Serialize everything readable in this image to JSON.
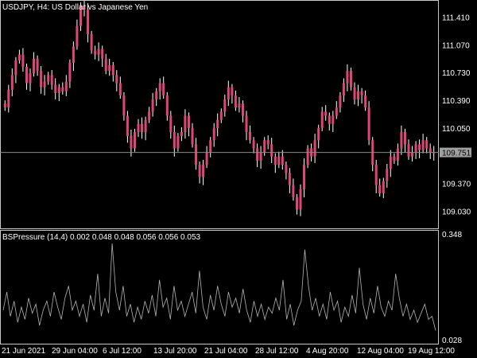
{
  "colors": {
    "background": "#000000",
    "frame": "#c8c8c8",
    "candle": "#e0457a",
    "wick": "#ffffff",
    "indicator": "#b4b4b4",
    "current_price_line": "#8a8a8a",
    "current_price_box": "#a0a0a0",
    "text": "#ffffff"
  },
  "main": {
    "header": "USDJPY, H4:  US Dollar vs Japanese Yen",
    "price_ticks": [
      "111.410",
      "111.070",
      "110.730",
      "110.390",
      "110.050",
      "109.370",
      "109.030"
    ],
    "current_price": "109.751"
  },
  "indicator": {
    "header": "BSPressure (14,4) 0.002 0.048 0.048 0.056 0.056 0.053",
    "ticks": [
      "0.348",
      "0.028"
    ]
  },
  "time_axis": {
    "labels": [
      "21 Jun 2021",
      "29 Jun 04:00",
      "6 Jul 12:00",
      "13 Jul 20:00",
      "21 Jul 04:00",
      "28 Jul 12:00",
      "4 Aug 20:00",
      "12 Aug 04:00",
      "19 Aug 12:00"
    ]
  },
  "chart_data": [
    {
      "type": "candlestick",
      "title": "USDJPY, H4:  US Dollar vs Japanese Yen",
      "ylim": [
        108.83,
        111.6
      ],
      "y_ticks": [
        111.41,
        111.07,
        110.73,
        110.39,
        110.05,
        109.37,
        109.03
      ],
      "current_price": 109.751,
      "x_labels": [
        "21 Jun 2021",
        "29 Jun 04:00",
        "6 Jul 12:00",
        "13 Jul 20:00",
        "21 Jul 04:00",
        "28 Jul 12:00",
        "4 Aug 20:00",
        "12 Aug 04:00",
        "19 Aug 12:00"
      ],
      "close": [
        110.3,
        110.52,
        110.7,
        110.88,
        110.95,
        110.8,
        110.6,
        110.72,
        110.9,
        110.75,
        110.55,
        110.62,
        110.7,
        110.58,
        110.48,
        110.55,
        110.5,
        110.62,
        110.85,
        111.05,
        111.3,
        111.55,
        111.5,
        111.2,
        111.0,
        110.95,
        111.02,
        110.9,
        110.75,
        110.82,
        110.7,
        110.6,
        110.45,
        110.2,
        109.95,
        109.8,
        110.0,
        110.1,
        110.0,
        110.15,
        110.25,
        110.4,
        110.5,
        110.6,
        110.45,
        110.2,
        110.0,
        109.8,
        109.95,
        110.0,
        110.2,
        110.05,
        109.85,
        109.6,
        109.45,
        109.6,
        109.75,
        109.9,
        110.05,
        110.15,
        110.25,
        110.4,
        110.55,
        110.45,
        110.3,
        110.35,
        110.2,
        110.0,
        109.9,
        109.8,
        109.65,
        109.75,
        109.9,
        109.85,
        109.7,
        109.6,
        109.7,
        109.6,
        109.5,
        109.35,
        109.2,
        109.05,
        109.3,
        109.6,
        109.8,
        109.7,
        109.9,
        110.05,
        110.25,
        110.2,
        110.1,
        110.2,
        110.3,
        110.45,
        110.6,
        110.75,
        110.55,
        110.4,
        110.5,
        110.45,
        110.3,
        109.9,
        109.6,
        109.35,
        109.25,
        109.4,
        109.55,
        109.7,
        109.65,
        109.8,
        110.0,
        109.85,
        109.7,
        109.75,
        109.85,
        109.78,
        109.9,
        109.8,
        109.75,
        109.751
      ]
    },
    {
      "type": "line",
      "title": "BSPressure (14,4) 0.002 0.048 0.048 0.056 0.056 0.053",
      "ylim": [
        0.028,
        0.348
      ],
      "y_ticks": [
        0.348,
        0.028
      ],
      "series": [
        {
          "values": [
            0.12,
            0.18,
            0.1,
            0.15,
            0.08,
            0.13,
            0.09,
            0.16,
            0.11,
            0.14,
            0.07,
            0.12,
            0.15,
            0.1,
            0.18,
            0.13,
            0.09,
            0.16,
            0.2,
            0.12,
            0.15,
            0.1,
            0.14,
            0.08,
            0.17,
            0.12,
            0.24,
            0.1,
            0.16,
            0.11,
            0.34,
            0.18,
            0.12,
            0.2,
            0.1,
            0.14,
            0.08,
            0.13,
            0.09,
            0.15,
            0.11,
            0.17,
            0.1,
            0.22,
            0.13,
            0.16,
            0.09,
            0.2,
            0.12,
            0.15,
            0.1,
            0.14,
            0.18,
            0.11,
            0.25,
            0.13,
            0.09,
            0.17,
            0.12,
            0.2,
            0.14,
            0.1,
            0.18,
            0.13,
            0.16,
            0.11,
            0.19,
            0.12,
            0.08,
            0.15,
            0.1,
            0.14,
            0.09,
            0.13,
            0.11,
            0.16,
            0.12,
            0.22,
            0.09,
            0.14,
            0.07,
            0.12,
            0.15,
            0.32,
            0.2,
            0.12,
            0.16,
            0.1,
            0.14,
            0.09,
            0.18,
            0.12,
            0.15,
            0.08,
            0.13,
            0.1,
            0.17,
            0.11,
            0.26,
            0.14,
            0.09,
            0.16,
            0.11,
            0.2,
            0.13,
            0.1,
            0.15,
            0.12,
            0.24,
            0.16,
            0.1,
            0.14,
            0.09,
            0.12,
            0.08,
            0.11,
            0.14,
            0.09,
            0.1,
            0.053
          ]
        }
      ]
    }
  ]
}
